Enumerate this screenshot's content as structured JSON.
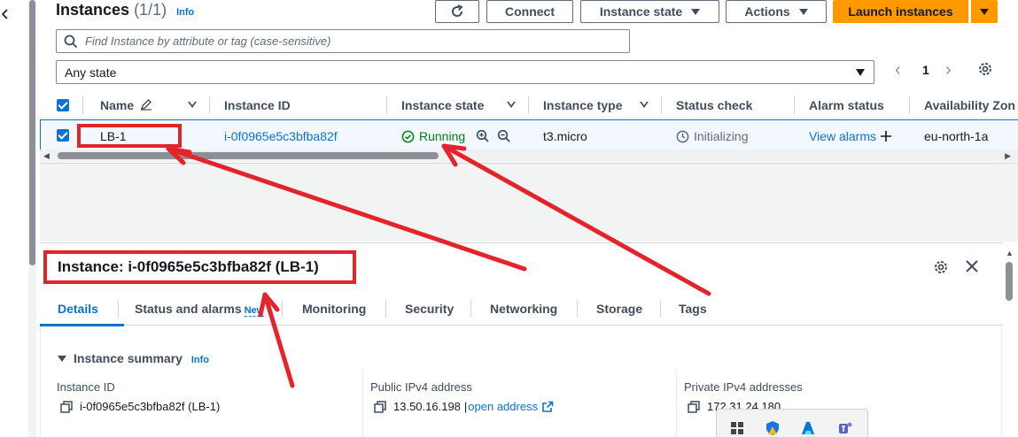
{
  "header": {
    "title": "Instances",
    "count": "(1/1)",
    "info": "Info",
    "connect": "Connect",
    "instance_state": "Instance state",
    "actions": "Actions",
    "launch": "Launch instances"
  },
  "search": {
    "placeholder": "Find Instance by attribute or tag (case-sensitive)"
  },
  "filter": {
    "selected": "Any state"
  },
  "pagination": {
    "page": "1"
  },
  "table": {
    "columns": [
      "Name",
      "Instance ID",
      "Instance state",
      "Instance type",
      "Status check",
      "Alarm status",
      "Availability Zon"
    ],
    "row": {
      "name": "LB-1",
      "instance_id": "i-0f0965e5c3bfba82f",
      "state": "Running",
      "type": "t3.micro",
      "status_check": "Initializing",
      "alarm": "View alarms",
      "az": "eu-north-1a"
    }
  },
  "details": {
    "title": "Instance: i-0f0965e5c3bfba82f (LB-1)",
    "tabs": [
      "Details",
      "Status and alarms",
      "Monitoring",
      "Security",
      "Networking",
      "Storage",
      "Tags"
    ],
    "new_badge": "New",
    "section_title": "Instance summary",
    "section_info": "Info",
    "fields": [
      {
        "label": "Instance ID",
        "value": "i-0f0965e5c3bfba82f (LB-1)"
      },
      {
        "label": "Public IPv4 address",
        "value": "13.50.16.198",
        "link": "open address"
      },
      {
        "label": "Private IPv4 addresses",
        "value": "172.31.24.180"
      }
    ]
  },
  "colors": {
    "accent": "#0972d3",
    "launch": "#ff9900",
    "running": "#037f0c",
    "annotation": "#e3242b"
  },
  "icons": [
    "refresh-icon",
    "search-icon",
    "gear-icon",
    "edit-icon",
    "check-circle-icon",
    "zoom-in-icon",
    "zoom-out-icon",
    "clock-icon",
    "plus-icon",
    "close-icon",
    "copy-icon",
    "external-link-icon"
  ]
}
